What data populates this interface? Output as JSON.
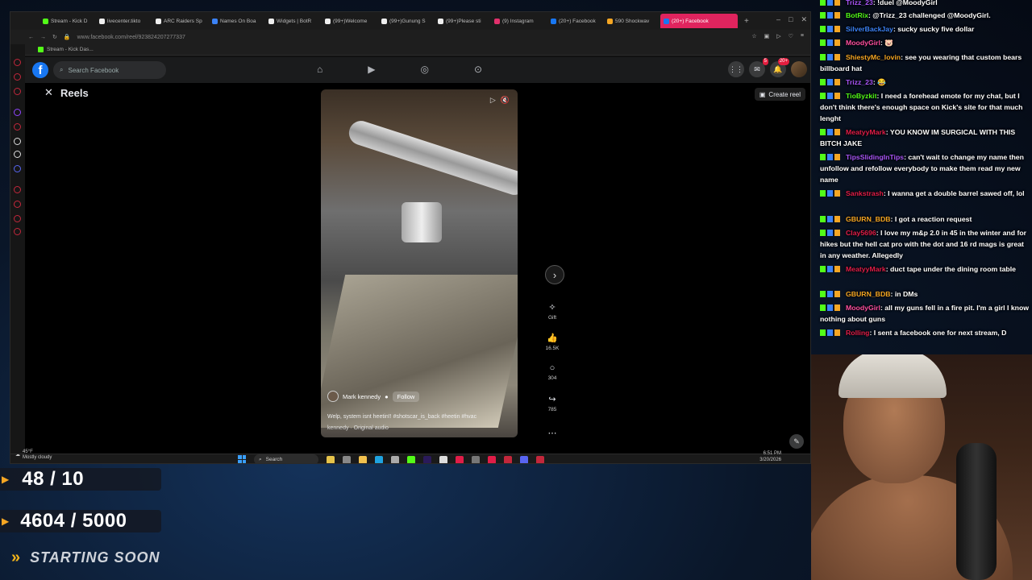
{
  "browser": {
    "tabs": [
      {
        "label": "Stream - Kick D",
        "color": "#53fc18"
      },
      {
        "label": "livecenter.tikto",
        "color": "#ffffff"
      },
      {
        "label": "ARC Raiders Sp",
        "color": "#ffffff"
      },
      {
        "label": "Names On Boa",
        "color": "#3b82f6"
      },
      {
        "label": "Widgets | BotR",
        "color": "#ffffff"
      },
      {
        "label": "(99+)Welcome",
        "color": "#ffffff"
      },
      {
        "label": "(99+)Gunung S",
        "color": "#ffffff"
      },
      {
        "label": "(99+)Please sti",
        "color": "#ffffff"
      },
      {
        "label": "(9) Instagram",
        "color": "#e1306c"
      },
      {
        "label": "(20+) Facebook",
        "color": "#1877f2"
      },
      {
        "label": "590 Shockwav",
        "color": "#f5a623"
      },
      {
        "label": "(20+) Facebook",
        "color": "#1877f2"
      }
    ],
    "url": "www.facebook.com/reel/923824207277337",
    "bookmark": "Stream - Kick Das..."
  },
  "facebook": {
    "search_placeholder": "Search Facebook",
    "reels_title": "Reels",
    "create_reel": "Create reel",
    "notif_badge_msg": "5",
    "notif_badge_bell": "20+",
    "accent": "#1877f2"
  },
  "reel": {
    "author": "Mark kennedy",
    "follow": "Follow",
    "caption": "Welp, system isnt heetin!! #shotscar_is_back #heetin #hvac",
    "audio": "kennedy · Original audio",
    "gift_label": "Gift",
    "likes": "16.5K",
    "comments": "304",
    "shares": "785"
  },
  "taskbar": {
    "temp": "45°F",
    "weather": "Mostly cloudy",
    "search": "Search",
    "time": "6:51 PM",
    "date": "3/20/2026"
  },
  "chat": [
    {
      "user": "Trizz_23",
      "color": "#a855f7",
      "text": ": !duel @MoodyGirl"
    },
    {
      "user": "BotRix",
      "color": "#53fc18",
      "text": ": @Trizz_23 challenged @MoodyGirl."
    },
    {
      "user": "SilverBackJay",
      "color": "#3b82f6",
      "text": ": sucky sucky five dollar"
    },
    {
      "user": "MoodyGirl",
      "color": "#ff4fa0",
      "text": ": 🐷"
    },
    {
      "user": "ShiestyMc_lovin",
      "color": "#f5a623",
      "text": ": see you wearing that custom bears billboard hat"
    },
    {
      "user": "Trizz_23",
      "color": "#a855f7",
      "text": ": 😂"
    },
    {
      "user": "TioByzkit",
      "color": "#53fc18",
      "text": ": I need a forehead emote for my chat, but I don't think there's enough space on Kick's site for that much lenght"
    },
    {
      "user": "MeatyyMark",
      "color": "#e11d48",
      "text": ": YOU KNOW IM SURGICAL WITH THIS BITCH JAKE"
    },
    {
      "user": "TipsSlidingInTips",
      "color": "#a855f7",
      "text": ": can't wait to change my name then unfollow and refollow everybody to make them read my new name"
    },
    {
      "user": "Sankstrash",
      "color": "#e11d48",
      "text": ": I wanna get a double barrel sawed off, lol"
    },
    {
      "user": "GBURN_BDB",
      "color": "#f5a623",
      "text": ": I got a reaction request"
    },
    {
      "user": "Clay5696",
      "color": "#e11d48",
      "text": ": I love my m&p 2.0 in 45 in the winter and for hikes but the hell cat pro with the dot and 16 rd mags is great in any weather. Allegedly"
    },
    {
      "user": "MeatyyMark",
      "color": "#e11d48",
      "text": ": duct tape under the dining room table"
    },
    {
      "user": "GBURN_BDB",
      "color": "#f5a623",
      "text": ": in DMs"
    },
    {
      "user": "MoodyGirl",
      "color": "#ff4fa0",
      "text": ": all my guns fell in a fire pit. I'm a girl I know nothing about guns"
    },
    {
      "user": "Rolling",
      "color": "#e11d48",
      "text": ": I sent a facebook one for next stream, D"
    }
  ],
  "overlay": {
    "counter1": "48 / 10",
    "counter2": "4604 / 5000",
    "starting": "STARTING SOON",
    "accent": "#f5a623"
  }
}
